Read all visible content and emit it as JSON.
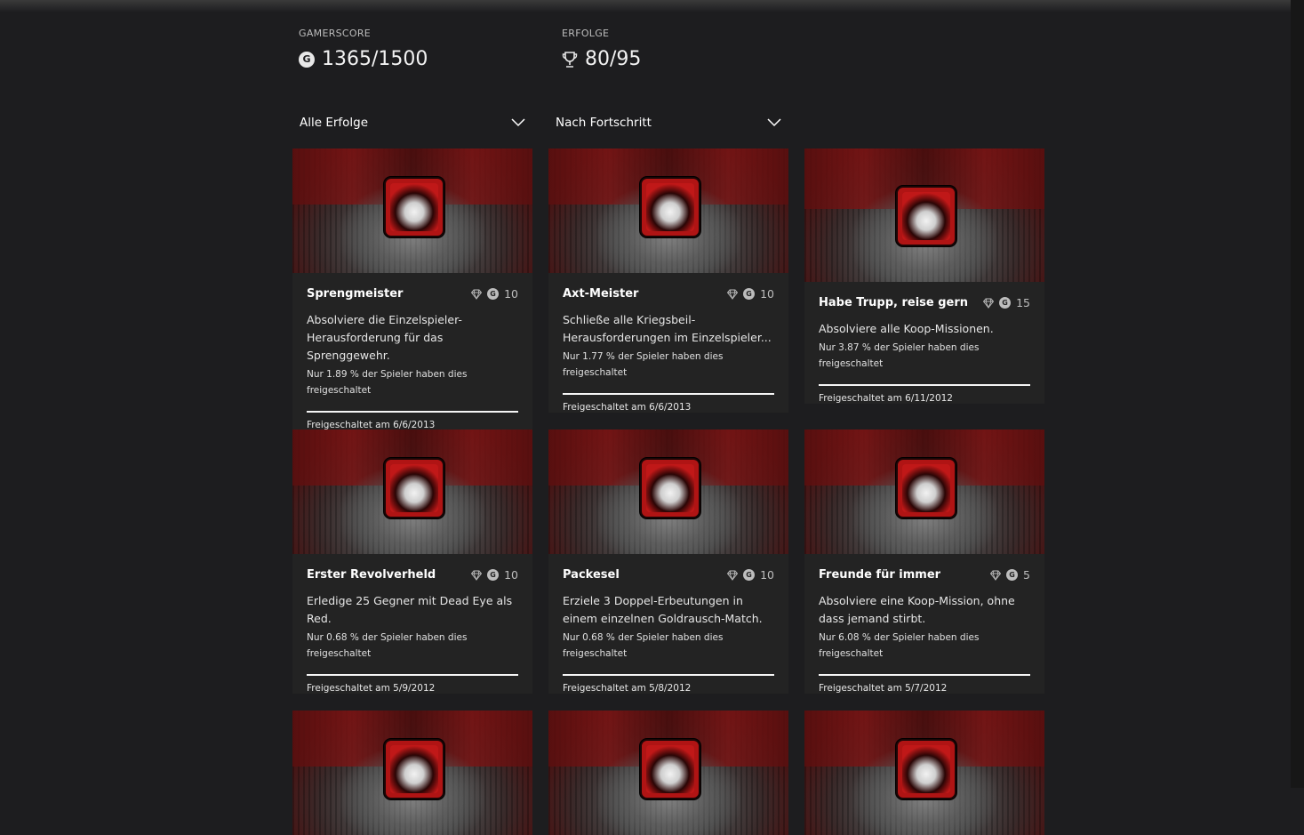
{
  "header": {
    "gamerscore_label": "GAMERSCORE",
    "gamerscore_value": "1365/1500",
    "achievements_label": "ERFOLGE",
    "achievements_value": "80/95"
  },
  "filters": {
    "filter_value": "Alle Erfolge",
    "sort_value": "Nach Fortschritt"
  },
  "cards": [
    {
      "title": "Sprengmeister",
      "points": "10",
      "description": "Absolviere die Einzelspieler-Herausforderung für das Sprenggewehr.",
      "rarity": "Nur 1.89 % der Spieler haben dies freigeschaltet",
      "unlocked": "Freigeschaltet am 6/6/2013",
      "icon": "dynamite-crate-icon"
    },
    {
      "title": "Axt-Meister",
      "points": "10",
      "description": "Schließe alle Kriegsbeil-Herausforderungen im Einzelspieler...",
      "rarity": "Nur 1.77 % der Spieler haben dies freigeschaltet",
      "unlocked": "Freigeschaltet am 6/6/2013",
      "icon": "skull-axes-icon"
    },
    {
      "title": "Habe Trupp, reise gern",
      "points": "15",
      "description": "Absolviere alle Koop-Missionen.",
      "rarity": "Nur 3.87 % der Spieler haben dies freigeschaltet",
      "unlocked": "Freigeschaltet am 6/11/2012",
      "icon": "posse-revolvers-icon"
    },
    {
      "title": "Erster Revolverheld",
      "points": "10",
      "description": "Erledige 25 Gegner mit Dead Eye als Red.",
      "rarity": "Nur 0.68 % der Spieler haben dies freigeschaltet",
      "unlocked": "Freigeschaltet am 5/9/2012",
      "icon": "eye-skull-icon"
    },
    {
      "title": "Packesel",
      "points": "10",
      "description": "Erziele 3 Doppel-Erbeutungen in einem einzelnen Goldrausch-Match.",
      "rarity": "Nur 0.68 % der Spieler haben dies freigeschaltet",
      "unlocked": "Freigeschaltet am 5/8/2012",
      "icon": "gold-bags-icon"
    },
    {
      "title": "Freunde für immer",
      "points": "5",
      "description": "Absolviere eine Koop-Mission, ohne dass jemand stirbt.",
      "rarity": "Nur 6.08 % der Spieler haben dies freigeschaltet",
      "unlocked": "Freigeschaltet am 5/7/2012",
      "icon": "three-skulls-icon"
    }
  ],
  "bottom_cards": [
    {
      "icon": "posse-skull-icon"
    },
    {
      "icon": "posse-crossed-guns-icon"
    },
    {
      "icon": "fifty-star-icon"
    }
  ],
  "colors": {
    "background": "#1d1d1f",
    "card": "#232323",
    "accent_red": "#b01414"
  }
}
